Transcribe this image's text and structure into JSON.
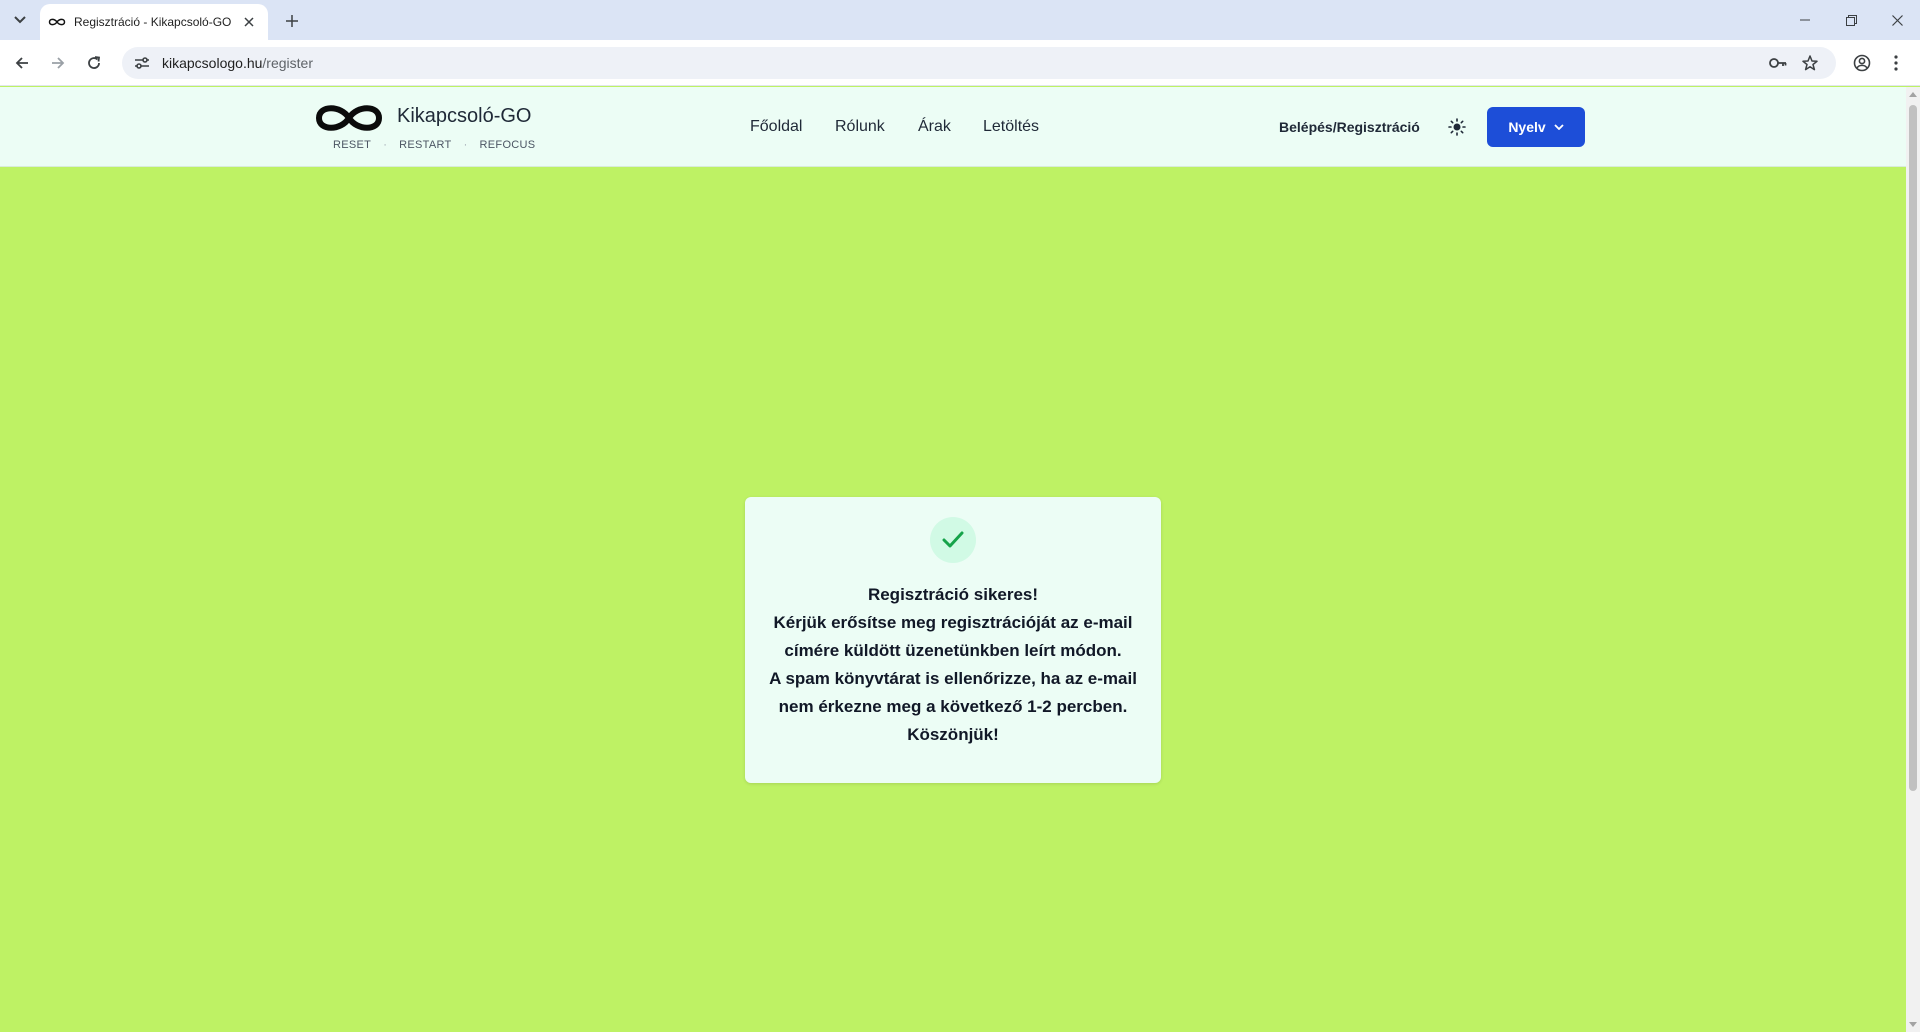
{
  "browser": {
    "tab_title": "Regisztráció - Kikapcsoló-GO -",
    "url_host": "kikapcsologo.hu",
    "url_path": "/register"
  },
  "header": {
    "brand": "Kikapcsoló-GO",
    "tagline": [
      "RESET",
      "RESTART",
      "REFOCUS"
    ],
    "nav": [
      "Főoldal",
      "Rólunk",
      "Árak",
      "Letöltés"
    ],
    "login": "Belépés/Regisztráció",
    "language_button": "Nyelv"
  },
  "card": {
    "lines": [
      "Regisztráció sikeres!",
      "Kérjük erősítse meg regisztrációját az e-mail",
      "címére küldött üzenetünkben leírt módon.",
      "A spam könyvtárat is ellenőrizze, ha az e-mail",
      "nem érkezne meg a következő 1-2 percben.",
      "Köszönjük!"
    ]
  },
  "colors": {
    "page_bg": "#bef264",
    "header_bg": "#ecfdf5",
    "card_bg": "#ecfdf5",
    "accent_button": "#1d4ed8",
    "check_green": "#16a34a"
  },
  "icons": [
    "tab-list-icon",
    "infinity-icon",
    "close-icon",
    "plus-icon",
    "minimize-icon",
    "restore-icon",
    "back-arrow-icon",
    "forward-arrow-icon",
    "reload-icon",
    "site-settings-icon",
    "key-icon",
    "star-icon",
    "profile-icon",
    "menu-dots-icon",
    "sun-icon",
    "chevron-down-icon",
    "checkmark-icon"
  ]
}
